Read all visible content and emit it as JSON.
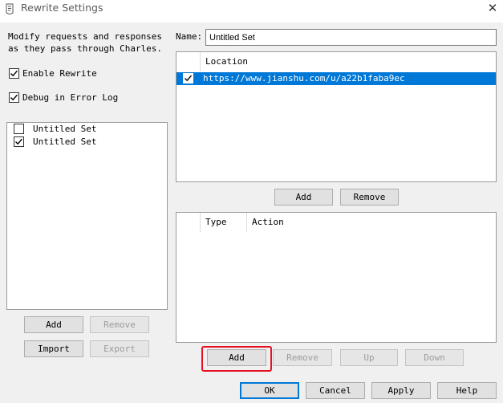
{
  "window": {
    "title": "Rewrite Settings",
    "close_glyph": "✕"
  },
  "description": "Modify requests and responses as they pass through Charles.",
  "options": {
    "enable_rewrite": {
      "label": "Enable Rewrite",
      "checked": true
    },
    "debug_error_log": {
      "label": "Debug in Error Log",
      "checked": true
    }
  },
  "sets": [
    {
      "label": "Untitled Set",
      "checked": false
    },
    {
      "label": "Untitled Set",
      "checked": true
    }
  ],
  "sets_buttons": {
    "add": "Add",
    "remove": "Remove",
    "import": "Import",
    "export": "Export"
  },
  "name_field": {
    "label": "Name:",
    "value": "Untitled Set"
  },
  "locations": {
    "header": "Location",
    "rows": [
      {
        "checked": true,
        "url": "https://www.jianshu.com/u/a22b1faba9ec",
        "selected": true
      }
    ],
    "add": "Add",
    "remove": "Remove"
  },
  "rules": {
    "headers": {
      "type": "Type",
      "action": "Action"
    },
    "add": "Add",
    "remove": "Remove",
    "up": "Up",
    "down": "Down"
  },
  "dialog_buttons": {
    "ok": "OK",
    "cancel": "Cancel",
    "apply": "Apply",
    "help": "Help"
  },
  "colors": {
    "selection": "#0078d7",
    "highlight": "#e81123"
  },
  "icons": {
    "app": "charles-app-icon",
    "close": "close-icon",
    "check": "checkmark-icon"
  }
}
